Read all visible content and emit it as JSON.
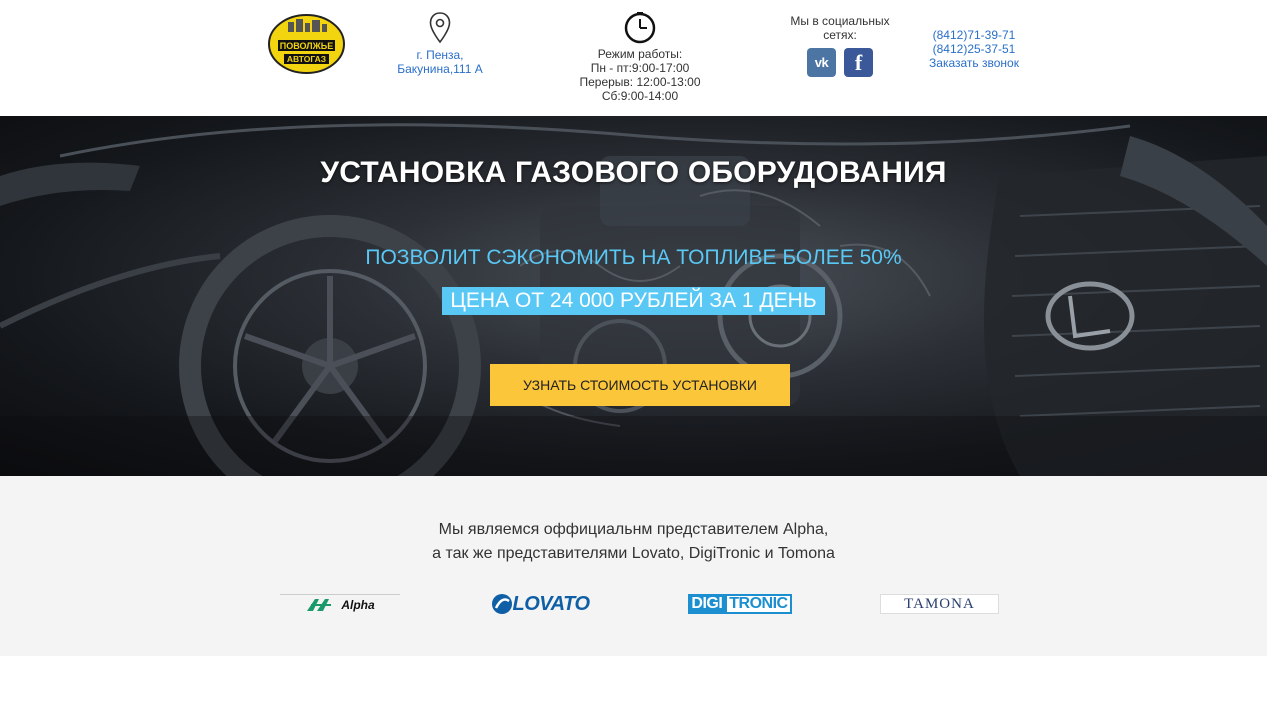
{
  "header": {
    "logo": {
      "line1": "ПОВОЛЖЬЕ",
      "line2": "АВТОГАЗ",
      "icon": "company-logo"
    },
    "address": {
      "icon": "map-pin-icon",
      "line1": "г. Пенза,",
      "line2": "Бакунина,111 А"
    },
    "hours": {
      "icon": "clock-icon",
      "title": "Режим работы:",
      "weekdays": "Пн - пт:9:00-17:00",
      "break": "Перерыв: 12:00-13:00",
      "saturday": "Сб:9:00-14:00"
    },
    "social": {
      "title_line1": "Мы в социальных",
      "title_line2": "сетях:",
      "vk_label": "vk",
      "fb_label": "f"
    },
    "contacts": {
      "phone1": "(8412)71-39-71",
      "phone2": "(8412)25-37-51",
      "callback": "Заказать звонок"
    }
  },
  "hero": {
    "title": "УСТАНОВКА ГАЗОВОГО ОБОРУДОВАНИЯ",
    "subtitle": "ПОЗВОЛИТ СЭКОНОМИТЬ НА ТОПЛИВЕ БОЛЕЕ 50%",
    "price": "ЦЕНА ОТ 24 000 РУБЛЕЙ ЗА 1 ДЕНЬ",
    "cta": "УЗНАТЬ СТОИМОСТЬ УСТАНОВКИ"
  },
  "partners": {
    "line1": "Мы являемся оффициальнм представителем Alpha,",
    "line2": "а так же представителями Lovato, DigiTronic и Tomona",
    "brands": {
      "alpha": "Alpha",
      "lovato": "LOVATO",
      "digi_a": "DIGI",
      "digi_b": "TRONIC",
      "tamona": "TAMONA"
    }
  },
  "colors": {
    "accent_blue": "#59c8f5",
    "cta_yellow": "#fcc63b",
    "link_blue": "#2a6fc9"
  }
}
